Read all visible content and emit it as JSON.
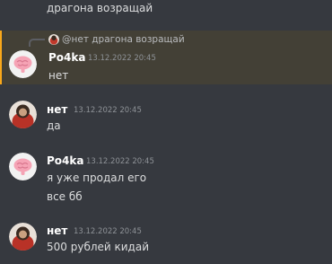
{
  "channel": {
    "previous_message_tail": "драгона возращай"
  },
  "messages": [
    {
      "author": "Po4ka",
      "avatar_icon": "brain-avatar-icon",
      "timestamp": "13.12.2022 20:45",
      "highlighted": true,
      "reply": {
        "text": "@нет драгона возращай",
        "avatar_icon": "red-avatar-icon"
      },
      "lines": [
        "нет"
      ]
    },
    {
      "author": "нет",
      "avatar_icon": "red-avatar-icon",
      "timestamp": "13.12.2022 20:45",
      "lines": [
        "да"
      ]
    },
    {
      "author": "Po4ka",
      "avatar_icon": "brain-avatar-icon",
      "timestamp": "13.12.2022 20:45",
      "lines": [
        "я уже продал его",
        "все бб"
      ]
    },
    {
      "author": "нет",
      "avatar_icon": "red-avatar-icon",
      "timestamp": "13.12.2022 20:45",
      "lines": [
        "500 рублей кидай"
      ]
    }
  ],
  "colors": {
    "background": "#36393f",
    "highlight_background": "#434036",
    "highlight_border": "#faa81a",
    "author_text": "#ffffff",
    "message_text": "#dcddde",
    "timestamp_text": "#8e9297"
  }
}
